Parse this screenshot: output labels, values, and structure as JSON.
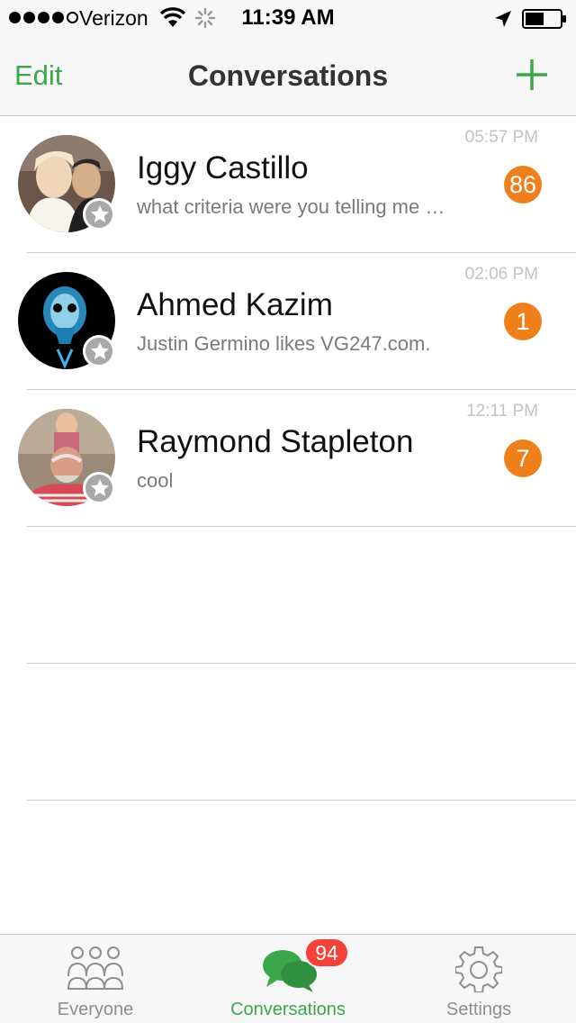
{
  "status_bar": {
    "carrier": "Verizon",
    "time": "11:39 AM",
    "signal_bars_filled": 4,
    "signal_bars_total": 5,
    "battery_level": 0.55,
    "icons": [
      "wifi-icon",
      "activity-spinner-icon",
      "location-arrow-icon",
      "battery-icon"
    ]
  },
  "nav": {
    "edit_label": "Edit",
    "title": "Conversations",
    "add_icon": "plus-icon"
  },
  "conversations": [
    {
      "name": "Iggy Castillo",
      "preview": "what criteria were you telling me about",
      "time": "05:57 PM",
      "unread": "86",
      "avatar": "wedding-couple-photo"
    },
    {
      "name": "Ahmed Kazim",
      "preview": "Justin Germino likes VG247.com.",
      "time": "02:06 PM",
      "unread": "1",
      "avatar": "glowing-skull-xray"
    },
    {
      "name": "Raymond Stapleton",
      "preview": "cool",
      "time": "12:11 PM",
      "unread": "7",
      "avatar": "man-with-child-photo"
    }
  ],
  "tabs": [
    {
      "label": "Everyone",
      "icon": "people-group-icon",
      "active": false
    },
    {
      "label": "Conversations",
      "icon": "chat-bubbles-icon",
      "active": true,
      "badge": "94"
    },
    {
      "label": "Settings",
      "icon": "gear-icon",
      "active": false
    }
  ],
  "colors": {
    "accent": "#3aa74a",
    "badge_orange": "#ef7f1a",
    "badge_red": "#f4413a",
    "inactive_tab": "#8e8e93"
  }
}
